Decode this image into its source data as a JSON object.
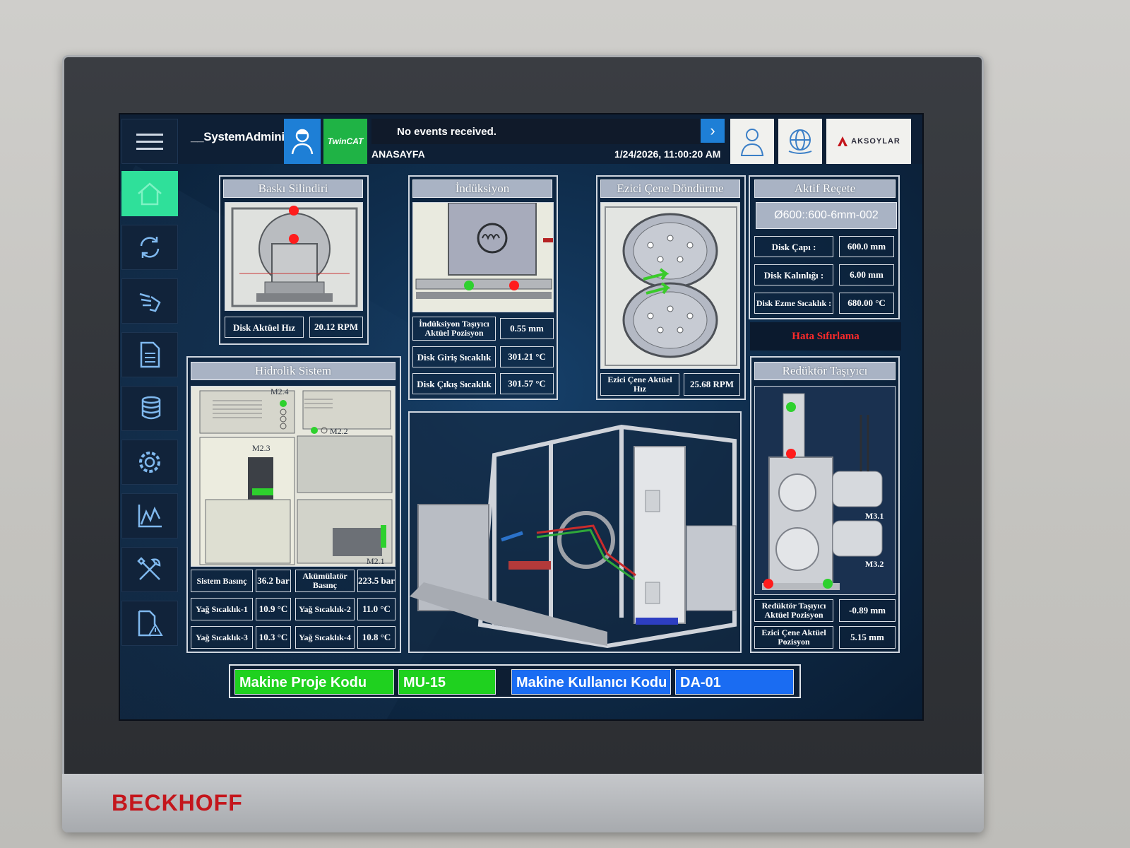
{
  "topbar": {
    "user": "__SystemAdminist",
    "twincat": "TwinCAT",
    "events": "No events received.",
    "events_arrow": "›",
    "page": "ANASAYFA",
    "datetime": "1/24/2026, 11:00:20 AM",
    "logo": "AKSOYLAR"
  },
  "sidebar": {
    "items": [
      {
        "name": "home-icon"
      },
      {
        "name": "refresh-icon"
      },
      {
        "name": "manual-hand-icon"
      },
      {
        "name": "document-icon"
      },
      {
        "name": "database-icon"
      },
      {
        "name": "gear-settings-icon"
      },
      {
        "name": "chart-icon"
      },
      {
        "name": "tools-icon"
      },
      {
        "name": "alarm-report-icon"
      }
    ]
  },
  "baski": {
    "title": "Baskı Silindiri",
    "speed_label": "Disk Aktüel Hız",
    "speed_value": "20.12 RPM"
  },
  "induksiyon": {
    "title": "İndüksiyon",
    "pos_label": "İndüksiyon Taşıyıcı Aktüel Pozisyon",
    "pos_value": "0.55 mm",
    "in_label": "Disk Giriş Sıcaklık",
    "in_value": "301.21 °C",
    "out_label": "Disk Çıkış Sıcaklık",
    "out_value": "301.57 °C"
  },
  "ezici": {
    "title": "Ezici Çene Döndürme",
    "speed_label": "Ezici Çene Aktüel Hız",
    "speed_value": "25.68 RPM"
  },
  "recete": {
    "title": "Aktif Reçete",
    "name": "Ø600::600-6mm-002",
    "cap_label": "Disk Çapı :",
    "cap_value": "600.0 mm",
    "kal_label": "Disk Kalınlığı :",
    "kal_value": "6.00 mm",
    "sic_label": "Disk Ezme Sıcaklık :",
    "sic_value": "680.00 °C",
    "reset": "Hata Sıfırlama"
  },
  "hidrolik": {
    "title": "Hidrolik Sistem",
    "labels": {
      "m24": "M2.4",
      "m22": "M2.2",
      "m23": "M2.3",
      "m21": "M2.1"
    },
    "rows": [
      {
        "l1": "Sistem Basınç",
        "v1": "36.2 bar",
        "l2": "Akümülatör Basınç",
        "v2": "223.5 bar"
      },
      {
        "l1": "Yağ Sıcaklık-1",
        "v1": "10.9 °C",
        "l2": "Yağ Sıcaklık-2",
        "v2": "11.0 °C"
      },
      {
        "l1": "Yağ Sıcaklık-3",
        "v1": "10.3 °C",
        "l2": "Yağ Sıcaklık-4",
        "v2": "10.8 °C"
      }
    ]
  },
  "reduktor": {
    "title": "Redüktör Taşıyıcı",
    "m31": "M3.1",
    "m32": "M3.2",
    "pos_label": "Redüktör Taşıyıcı Aktüel Pozisyon",
    "pos_value": "-0.89 mm",
    "ezici_label": "Ezici Çene Aktüel Pozisyon",
    "ezici_value": "5.15 mm"
  },
  "footer": {
    "proje_label": "Makine Proje Kodu",
    "proje_value": "MU-15",
    "kullanici_label": "Makine Kullanıcı Kodu",
    "kullanici_value": "DA-01"
  },
  "hardware": {
    "brand": "BECKHOFF"
  },
  "colors": {
    "active": "#2fe09a",
    "accent": "#1e7fd6",
    "ok": "#2ed12e",
    "alarm": "#ff1c1c",
    "footer_green": "#1fd11f",
    "footer_blue": "#1a6cf2"
  }
}
